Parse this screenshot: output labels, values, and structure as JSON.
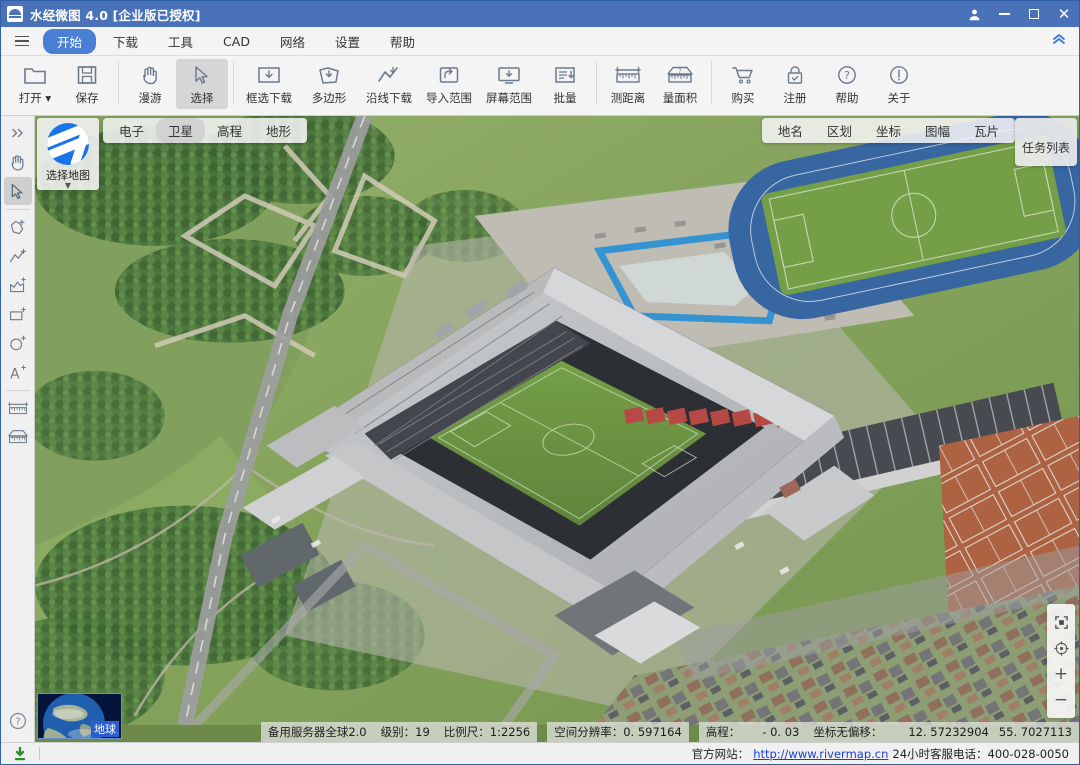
{
  "window": {
    "title": "水经微图 4.0 [企业版已授权]",
    "app_icon": "app-logo-icon",
    "controls": {
      "user": "user-icon",
      "minimize": "minimize-icon",
      "maximize": "maximize-icon",
      "close": "close-icon"
    }
  },
  "menubar": {
    "hamburger": "hamburger-icon",
    "items": [
      {
        "label": "开始",
        "active": true
      },
      {
        "label": "下载",
        "active": false
      },
      {
        "label": "工具",
        "active": false
      },
      {
        "label": "CAD",
        "active": false
      },
      {
        "label": "网络",
        "active": false
      },
      {
        "label": "设置",
        "active": false
      },
      {
        "label": "帮助",
        "active": false
      }
    ],
    "collapse": "chevron-double-up-icon"
  },
  "ribbon": {
    "items": [
      {
        "label": "打开 ▾",
        "icon": "folder-open-icon",
        "selected": false
      },
      {
        "label": "保存",
        "icon": "save-disk-icon",
        "selected": false
      },
      {
        "sep": true
      },
      {
        "label": "漫游",
        "icon": "hand-pan-icon",
        "selected": false
      },
      {
        "label": "选择",
        "icon": "cursor-arrow-icon",
        "selected": true
      },
      {
        "sep": true
      },
      {
        "label": "框选下载",
        "icon": "rect-download-icon",
        "selected": false
      },
      {
        "label": "多边形",
        "icon": "polygon-download-icon",
        "selected": false
      },
      {
        "label": "沿线下载",
        "icon": "polyline-download-icon",
        "selected": false
      },
      {
        "label": "导入范围",
        "icon": "import-range-icon",
        "selected": false
      },
      {
        "label": "屏幕范围",
        "icon": "screen-range-icon",
        "selected": false
      },
      {
        "label": "批量",
        "icon": "batch-list-icon",
        "selected": false
      },
      {
        "sep": true
      },
      {
        "label": "测距离",
        "icon": "measure-distance-icon",
        "selected": false
      },
      {
        "label": "量面积",
        "icon": "measure-area-icon",
        "selected": false
      },
      {
        "sep": true
      },
      {
        "label": "购买",
        "icon": "cart-icon",
        "selected": false
      },
      {
        "label": "注册",
        "icon": "lock-register-icon",
        "selected": false
      },
      {
        "label": "帮助",
        "icon": "question-circle-icon",
        "selected": false
      },
      {
        "label": "关于",
        "icon": "info-circle-icon",
        "selected": false
      }
    ]
  },
  "left_toolbar": {
    "items": [
      {
        "name": "collapse-panel-icon",
        "selected": false
      },
      {
        "name": "hand-pan-icon",
        "selected": false
      },
      {
        "name": "cursor-arrow-icon",
        "selected": true
      },
      {
        "sep": true
      },
      {
        "name": "add-polygon-icon",
        "selected": false
      },
      {
        "name": "add-polyline-icon",
        "selected": false
      },
      {
        "name": "add-filled-polygon-icon",
        "selected": false
      },
      {
        "name": "add-rectangle-icon",
        "selected": false
      },
      {
        "name": "add-circle-icon",
        "selected": false
      },
      {
        "name": "add-text-icon",
        "selected": false
      },
      {
        "sep": true
      },
      {
        "name": "measure-distance-icon",
        "selected": false
      },
      {
        "name": "measure-area-icon",
        "selected": false
      }
    ],
    "help": "question-circle-icon"
  },
  "map": {
    "layer_chips": [
      {
        "label": "电子",
        "active": false
      },
      {
        "label": "卫星",
        "active": true
      },
      {
        "label": "高程",
        "active": false
      },
      {
        "label": "地形",
        "active": false
      }
    ],
    "overlay_chips": [
      {
        "label": "地名",
        "active": false
      },
      {
        "label": "区划",
        "active": false
      },
      {
        "label": "坐标",
        "active": false
      },
      {
        "label": "图幅",
        "active": false
      },
      {
        "label": "瓦片",
        "active": false
      }
    ],
    "task_list_label": "任务列表",
    "map_selector": {
      "label": "选择地图",
      "icon": "earth-globe-icon",
      "caret": "▼"
    },
    "earth_thumb_label": "地球",
    "zoom_controls": [
      {
        "name": "fullscreen-icon"
      },
      {
        "name": "recenter-target-icon"
      },
      {
        "name": "zoom-in-icon",
        "label": "+"
      },
      {
        "name": "zoom-out-icon",
        "label": "−"
      }
    ]
  },
  "statusbar": {
    "server": "备用服务器全球2.0",
    "level_label": "级别：",
    "level_value": "19",
    "scale_label": "比例尺：",
    "scale_value": "1:2256",
    "resolution_label": "空间分辨率：",
    "resolution_value": "0. 597164",
    "elevation_label": "高程：",
    "elevation_value": "- 0. 03",
    "offset_label": "坐标无偏移：",
    "lon": "12. 57232904",
    "lat": "55. 7027113"
  },
  "footer": {
    "download_icon": "download-status-icon",
    "site_label": "官方网站：",
    "site_url": "http://www.rivermap.cn",
    "hotline": "24小时客服电话：400-028-0050"
  },
  "colors": {
    "titlebar": "#4a72b8",
    "accent": "#4a7fd4",
    "link": "#1a3fd0",
    "chrome": "#f4f4f4"
  }
}
